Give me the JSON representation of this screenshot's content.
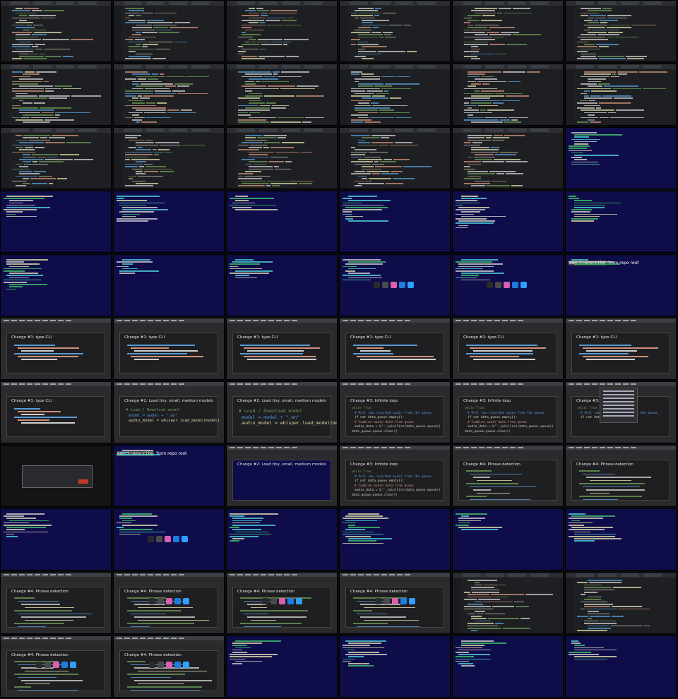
{
  "page": {
    "background": "#0b0b10"
  },
  "colors": {
    "ide_bg": "#1e1f22",
    "terminal_bg": "#0f0c4a",
    "slide_bg": "#2b2b2e",
    "code_green": "#6a9955",
    "code_yellow": "#dcdcaa",
    "code_blue": "#569cd6",
    "code_orange": "#ce9178",
    "code_white": "#cfcfcf",
    "term_green": "#3ec46a",
    "term_cyan": "#4fd1d9"
  },
  "rows": [
    {
      "tiles": [
        "ide",
        "ide",
        "ide",
        "ide",
        "ide",
        "ide"
      ]
    },
    {
      "tiles": [
        "ide",
        "ide",
        "ide",
        "ide",
        "ide",
        "ide"
      ]
    },
    {
      "tiles": [
        "ide",
        "ide",
        "ide",
        "ide",
        "ide",
        "term"
      ]
    },
    {
      "tiles": [
        "term",
        "term",
        "term",
        "term",
        "term",
        "term"
      ]
    },
    {
      "tiles": [
        "term",
        "term",
        "term",
        "term_dock",
        "term_dock",
        "big_command"
      ]
    },
    {
      "tiles": [
        "slide_c1",
        "slide_c1",
        "slide_c1",
        "slide_c1",
        "slide_c1",
        "slide_c1"
      ]
    },
    {
      "tiles": [
        "slide_c1",
        "slide_model",
        "slide_model_big",
        "slide_loop",
        "slide_loop",
        "slide_menu"
      ]
    },
    {
      "tiles": [
        "slide_dialog",
        "big_command",
        "slide_term",
        "slide_loop2",
        "slide_phrase",
        "slide_phrase"
      ]
    },
    {
      "tiles": [
        "term",
        "term_dock",
        "term",
        "term",
        "term",
        "term"
      ]
    },
    {
      "tiles": [
        "slide_phrase",
        "slide_phrase_dock",
        "slide_phrase_dock",
        "slide_phrase_dock",
        "ide",
        "ide"
      ]
    },
    {
      "tiles": [
        "slide_phrase_dock",
        "slide_phrase_dock",
        "term",
        "term",
        "term",
        "term"
      ]
    }
  ],
  "slides": {
    "change1": {
      "title": "Change #1: type CLI"
    },
    "change2": {
      "title": "Change #2: Load tiny, small, medium models"
    },
    "change3": {
      "title": "Change #3: Infinite loop"
    },
    "change4": {
      "title": "Change #4: Phrase detection"
    }
  },
  "code_snippets": {
    "model_comment": "# Load / Download model",
    "model_line1": "model = model + \".en\"",
    "model_line2": "audio_model = whisper.load_model(model)",
    "loop_line1": "while True:",
    "loop_line2": "# Pull raw recorded audio from the queue.",
    "loop_line3": "if not data_queue.empty():",
    "loop_line4": "# Combine audio data from queue",
    "loop_line5": "audio_data = b''.join(list(data_queue.queue))",
    "loop_line6": "data_queue.queue.clear()"
  },
  "command": {
    "name": "mmo.transcribe",
    "text": "from repo root"
  },
  "dock_colors": [
    "#2b2b2b",
    "#4a4a4a",
    "#d95fb0",
    "#1f7de0",
    "#2fa0ff"
  ]
}
